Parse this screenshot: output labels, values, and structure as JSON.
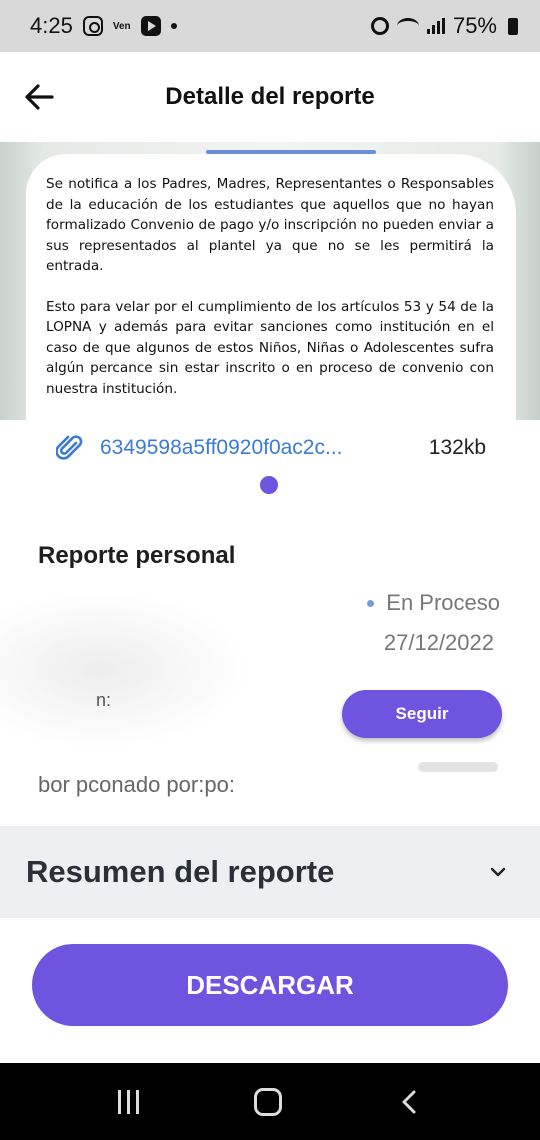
{
  "status_bar": {
    "time": "4:25",
    "carrier_tag": "Ven",
    "battery": "75%"
  },
  "header": {
    "title": "Detalle del reporte"
  },
  "attachment_image": {
    "paragraph_1": "Se notifica a los Padres, Madres, Representantes o Responsables de la educación de los estudiantes que aquellos que no hayan formalizado Convenio de pago y/o inscripción no pueden enviar a sus representados al plantel ya que no se les permitirá la entrada.",
    "paragraph_2": "Esto para velar por el cumplimiento de los artículos 53 y 54 de la LOPNA y además para evitar sanciones como institución en el caso de que algunos de estos Niños, Niñas o Adolescentes sufra algún percance sin estar inscrito o en proceso de convenio con nuestra institución."
  },
  "file": {
    "name": "6349598a5ff0920f0ac2c...",
    "size": "132kb"
  },
  "report": {
    "section_title": "Reporte personal",
    "status": "En Proceso",
    "date": "27/12/2022",
    "redacted_label": "n:",
    "follow_label": "Seguir",
    "reported_by": "bor pconado por:po:"
  },
  "summary": {
    "title": "Resumen del reporte"
  },
  "download": {
    "label": "DESCARGAR"
  },
  "colors": {
    "accent": "#6f54e0",
    "link": "#3a7bd5",
    "status_dot": "#7a9ae0"
  }
}
